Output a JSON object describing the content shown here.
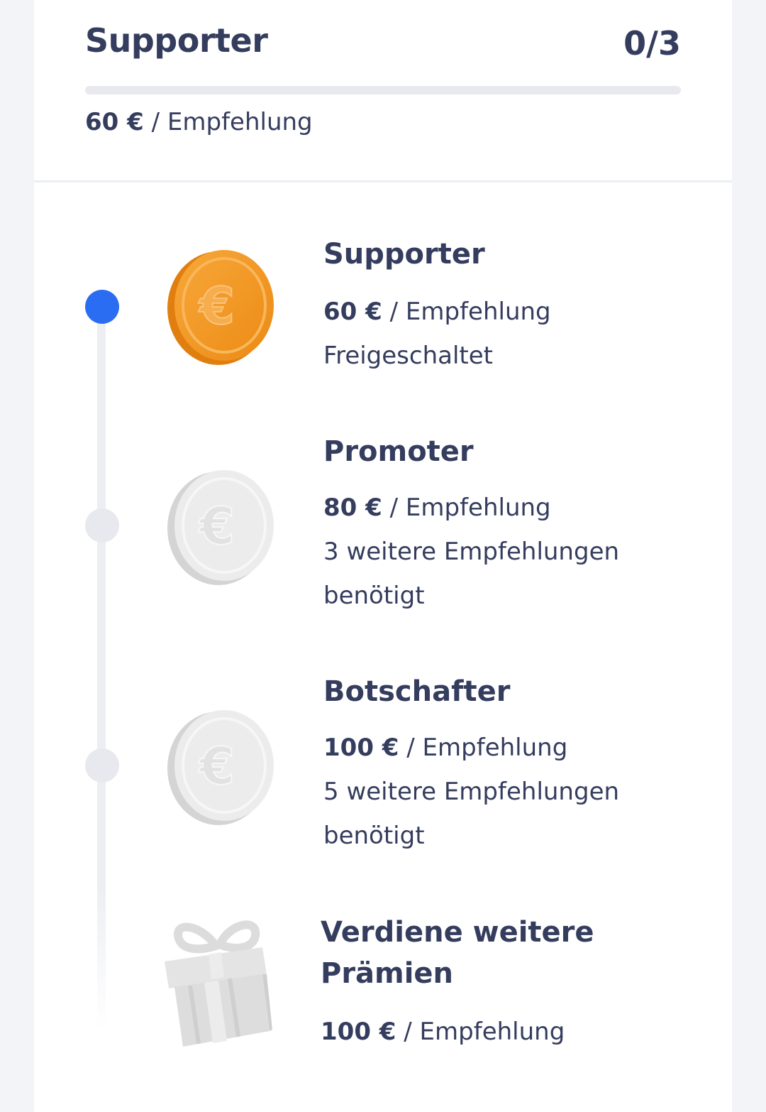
{
  "header": {
    "title": "Supporter",
    "count": "0/3",
    "progress": 0,
    "rate_amount": "60 €",
    "rate_suffix": " / Empfehlung"
  },
  "colors": {
    "accent": "#2a6cf2",
    "text": "#353d5e",
    "inactive": "#e8e9ee",
    "coin_gold": "#f0951f",
    "coin_silver": "#e9e9e9"
  },
  "tiers": [
    {
      "title": "Supporter",
      "amount": "60 €",
      "suffix": " / Empfehlung",
      "status": "Freigeschaltet",
      "icon": "gold-euro-coin-icon",
      "active": true
    },
    {
      "title": "Promoter",
      "amount": "80 €",
      "suffix": " / Empfehlung",
      "status_line1": "3 weitere Empfehlungen",
      "status_line2": "benötigt",
      "icon": "silver-euro-coin-icon",
      "active": false
    },
    {
      "title": "Botschafter",
      "amount": "100 €",
      "suffix": " / Empfehlung",
      "status_line1": "5 weitere Empfehlungen",
      "status_line2": "benötigt",
      "icon": "silver-euro-coin-icon",
      "active": false
    },
    {
      "title_line1": "Verdiene weitere",
      "title_line2": "Prämien",
      "amount": "100 €",
      "suffix": " / Empfehlung",
      "icon": "gift-icon"
    }
  ]
}
